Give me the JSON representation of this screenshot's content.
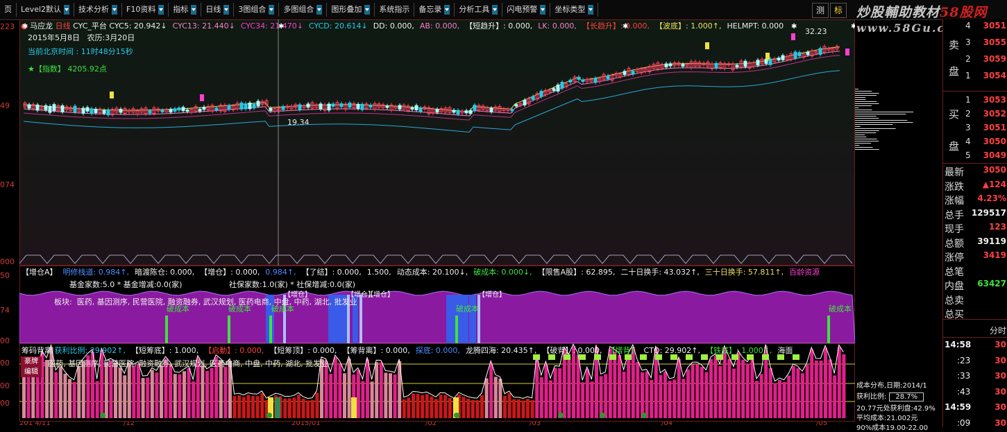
{
  "toolbar": {
    "items": [
      {
        "label": "页",
        "dd": false
      },
      {
        "label": "Level2默认",
        "dd": true
      },
      {
        "label": "技术分析",
        "dd": true
      },
      {
        "label": "F10资料",
        "dd": true
      },
      {
        "label": "指标",
        "dd": true
      },
      {
        "label": "日线",
        "dd": true
      },
      {
        "label": "3图组合",
        "dd": true
      },
      {
        "label": "多图组合",
        "dd": true
      },
      {
        "label": "图形叠加",
        "dd": true
      },
      {
        "label": "系统指示",
        "dd": false
      },
      {
        "label": "备忘录",
        "dd": true
      },
      {
        "label": "分析工具",
        "dd": true
      },
      {
        "label": "闪电预警",
        "dd": true
      },
      {
        "label": "坐标类型",
        "dd": true
      }
    ],
    "right_buttons": [
      "测",
      "标"
    ]
  },
  "watermark": {
    "prefix": "炒股輔助教材",
    "red": "58股网",
    "url": "www.58Gu.com"
  },
  "main": {
    "stock_name": "马应龙",
    "period": "日线",
    "indicator": "CYC_平台",
    "cyc_items": [
      {
        "text": "CYC5: 20.942↓",
        "color": "white"
      },
      {
        "text": "CYC13: 21.440↓",
        "color": "pink"
      },
      {
        "text": "CYC34: 21.470↓",
        "color": "magenta"
      },
      {
        "text": "CYCD: 20.614↓",
        "color": "cyan"
      },
      {
        "text": "DD: 0.000,",
        "color": "white"
      },
      {
        "text": "AB: 0.000,",
        "color": "pink"
      },
      {
        "text": "【短趋升】: 0.000,",
        "color": "white"
      },
      {
        "text": "LK: 0.000,",
        "color": "pink"
      },
      {
        "text": "【长趋升】: 0.000,",
        "color": "red"
      },
      {
        "text": "【波底】: 1.000↑,",
        "color": "yellow"
      },
      {
        "text": "HELMPT: 0.000",
        "color": "white"
      }
    ],
    "date": "2015年5月8日",
    "lunar": "农历:3月20日",
    "time_label": "当前北京时间  : 11时48分15秒",
    "index_label": "★【指数】  4205.92点",
    "y_labels": [
      "223",
      "49",
      "074",
      "000"
    ],
    "max_price": "32.23",
    "min_price": "19.34"
  },
  "panel2": {
    "line1_items": [
      {
        "text": "【增仓A】",
        "color": "white"
      },
      {
        "text": "明修栈道: 0.984↑,",
        "color": "blue"
      },
      {
        "text": "暗渡陈仓: 0.000,",
        "color": "white"
      },
      {
        "text": "【增仓】: 0.000,",
        "color": "white"
      },
      {
        "text": "0.984↑,",
        "color": "blue"
      },
      {
        "text": "【了结】: 0.000,",
        "color": "white"
      },
      {
        "text": "1.500,",
        "color": "white"
      },
      {
        "text": "动态成本: 20.100↓,",
        "color": "white"
      },
      {
        "text": "破成本: 0.000↓,",
        "color": "green"
      },
      {
        "text": "【限售A股】: 62.895,",
        "color": "white"
      },
      {
        "text": "二十日换手: 43.032↑,",
        "color": "white"
      },
      {
        "text": "三十日换手: 57.811↑,",
        "color": "yellow"
      },
      {
        "text": "百龄资源",
        "color": "magenta"
      }
    ],
    "fund_line": "基金家数:5.0 * 基金增减:0.0(家)",
    "social_line": "社保家数:1.0(家) * 社保增减:0.0(家)",
    "sector_label": "板块:",
    "sectors": "医药, 基因测序, 民营医院, 融资融券, 武汉规划, 医药电商, 中盘, 中药, 湖北, 批发业",
    "y_labels": [
      "50",
      "74",
      "00"
    ],
    "zengcang_labels": [
      "【增仓】",
      "【增仓】",
      "【增仓】",
      "【增仓】"
    ],
    "pochengben_labels": [
      "破成本",
      "破成本",
      "破成本",
      "破成本",
      "破成本"
    ]
  },
  "panel3": {
    "title": "筹码背离",
    "items": [
      {
        "text": "获利比例: 29.902↑,",
        "color": "cyan"
      },
      {
        "text": "【短筹底】: 1.000,",
        "color": "white"
      },
      {
        "text": "【启動】: 0.000,",
        "color": "red"
      },
      {
        "text": "【短筹顶】: 0.000,",
        "color": "white"
      },
      {
        "text": "【筹背离】: 0.000,",
        "color": "white"
      },
      {
        "text": "探底: 0.000,",
        "color": "blue"
      },
      {
        "text": "龙腾四海: 20.435↑,",
        "color": "white"
      },
      {
        "text": "【破背】: 0.000,",
        "color": "white"
      },
      {
        "text": "【增背】",
        "color": "green"
      },
      {
        "text": "CTQ: 29.902↑,",
        "color": "white"
      },
      {
        "text": "【铁底】: 1.000↑,",
        "color": "green"
      },
      {
        "text": "海面",
        "color": "white"
      }
    ],
    "hao_label1": "豪牌",
    "hao_label2": "编辑",
    "sectors": ": 医药, 基因测序, 民营医院, 融资融券, 武汉规划, 医药电商, 中盘, 中药, 湖北, 批发业",
    "y_labels": [
      "00",
      "00",
      "00"
    ],
    "x_labels": [
      "201 4/11",
      "/12",
      "2015/01",
      "/02",
      "/03",
      "/04",
      "/05"
    ]
  },
  "cost": {
    "title": "成本分布,日期:2014/1",
    "profit_label": "获利比例:",
    "profit_value": "28.7%",
    "line3": "20.77元处获利盘:42.9%",
    "line4": "平均成本:21.002元",
    "line5": "90%成本19.00-22.00"
  },
  "sidebar": {
    "ask_label1": "卖",
    "ask_label2": "盘",
    "bid_label1": "买",
    "bid_label2": "盘",
    "ask_rows": [
      {
        "n": "4",
        "p": "3051"
      },
      {
        "n": "3",
        "p": "3055"
      },
      {
        "n": "2",
        "p": "3059"
      },
      {
        "n": "1",
        "p": "3054"
      }
    ],
    "bid_rows": [
      {
        "n": "1",
        "p": "3053"
      },
      {
        "n": "2",
        "p": "3052"
      },
      {
        "n": "3",
        "p": "3051"
      },
      {
        "n": "4",
        "p": "3050"
      },
      {
        "n": "5",
        "p": "3049"
      }
    ],
    "stats": [
      {
        "k": "最新",
        "v": "3050",
        "c": "#ff4040"
      },
      {
        "k": "涨跌",
        "v": "▲124",
        "c": "#ff4040"
      },
      {
        "k": "涨幅",
        "v": "4.23%",
        "c": "#ff4040"
      },
      {
        "k": "总手",
        "v": "129517",
        "c": "#f0f0f0"
      },
      {
        "k": "现手",
        "v": "123",
        "c": "#ff4040"
      },
      {
        "k": "总额",
        "v": "39119",
        "c": "#f0f0f0"
      },
      {
        "k": "涨停",
        "v": "3419",
        "c": "#ff4040"
      },
      {
        "k": "总笔",
        "v": "",
        "c": "#f0f0f0"
      },
      {
        "k": "内盘",
        "v": "63427",
        "c": "#3fe23f"
      },
      {
        "k": "总卖",
        "v": "",
        "c": "#f0f0f0"
      },
      {
        "k": "总买",
        "v": "",
        "c": "#f0f0f0"
      }
    ],
    "fenshi": "分时",
    "ticks": [
      {
        "t": "14:58",
        "v": "30",
        "bold": true
      },
      {
        "t": ":23",
        "v": "30",
        "bold": false
      },
      {
        "t": ":33",
        "v": "30",
        "bold": false
      },
      {
        "t": ":43",
        "v": "30",
        "bold": false
      },
      {
        "t": "14:59",
        "v": "30",
        "bold": true
      },
      {
        "t": ":09",
        "v": "30",
        "bold": false
      }
    ]
  }
}
